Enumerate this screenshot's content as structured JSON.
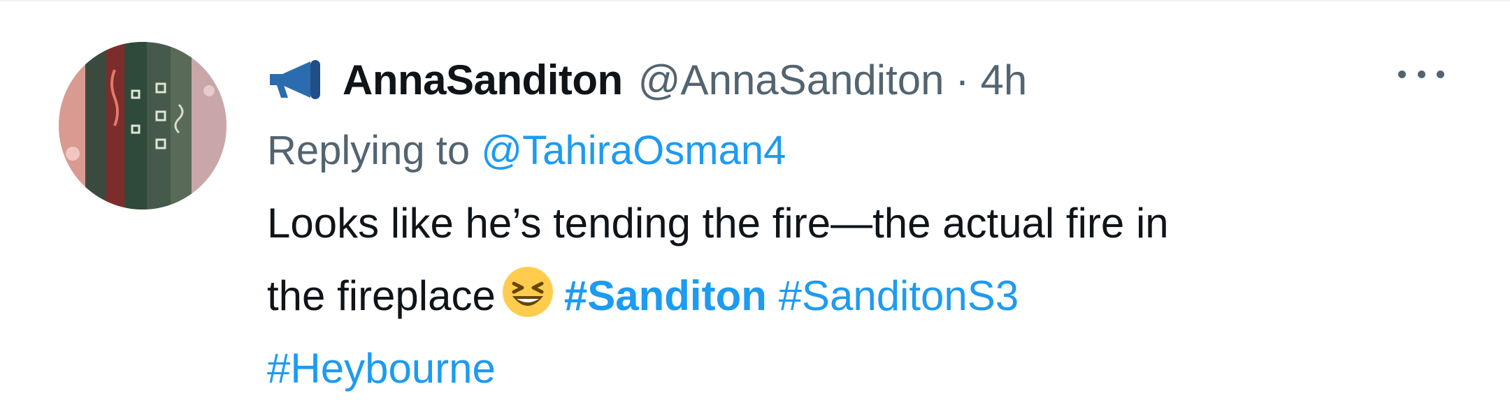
{
  "tweet": {
    "display_name": "AnnaSanditon",
    "handle": "@AnnaSanditon",
    "separator": "·",
    "time": "4h",
    "replying_prefix": "Replying to",
    "replying_to": "@TahiraOsman4",
    "text_line1": "Looks like he’s tending the fire—the actual fire in",
    "text_line2_prefix": "the fireplace",
    "emoji": "laughing-face",
    "hashtags": [
      "#Sanditon",
      "#SanditonS3",
      "#Heybourne"
    ]
  },
  "colors": {
    "text": "#0f1419",
    "secondary": "#536471",
    "link": "#1d9bf0"
  },
  "icons": {
    "name_badge": "megaphone-icon",
    "more": "more-options-icon"
  }
}
